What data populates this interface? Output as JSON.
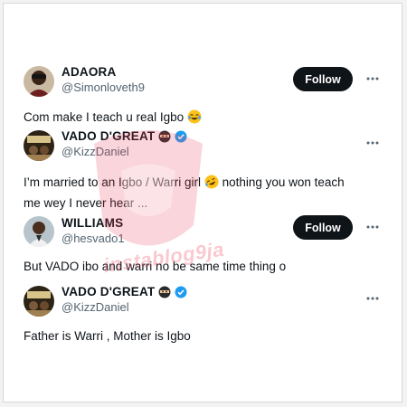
{
  "tweets": [
    {
      "name": "ADAORA",
      "handle": "@Simonloveth9",
      "follow_label": "Follow",
      "verified": false,
      "text": "Com make I teach u real Igbo",
      "emoji_after": "joy-emoji"
    },
    {
      "name": "VADO D'GREAT",
      "handle": "@KizzDaniel",
      "verified": true,
      "name_icon": "ninja-emoji",
      "text_line1_a": "I’m married to an Igbo / Warri girl",
      "text_line1_b": "nothing you won teach",
      "text_line2": "me wey I never hear ...",
      "emoji_after": "rofl-emoji"
    },
    {
      "name": "WILLIAMS",
      "handle": "@hesvado1",
      "follow_label": "Follow",
      "verified": false,
      "text": "But VADO ibo and warri no be same time thing o"
    },
    {
      "name": "VADO D'GREAT",
      "handle": "@KizzDaniel",
      "verified": true,
      "name_icon": "ninja-emoji",
      "text": "Father is Warri , Mother is Igbo"
    }
  ],
  "watermark": {
    "text": "instablog9ja",
    "color": "#e83e5a"
  },
  "colors": {
    "verified": "#1d9bf0",
    "follow_bg": "#0f1419",
    "handle": "#536471"
  }
}
